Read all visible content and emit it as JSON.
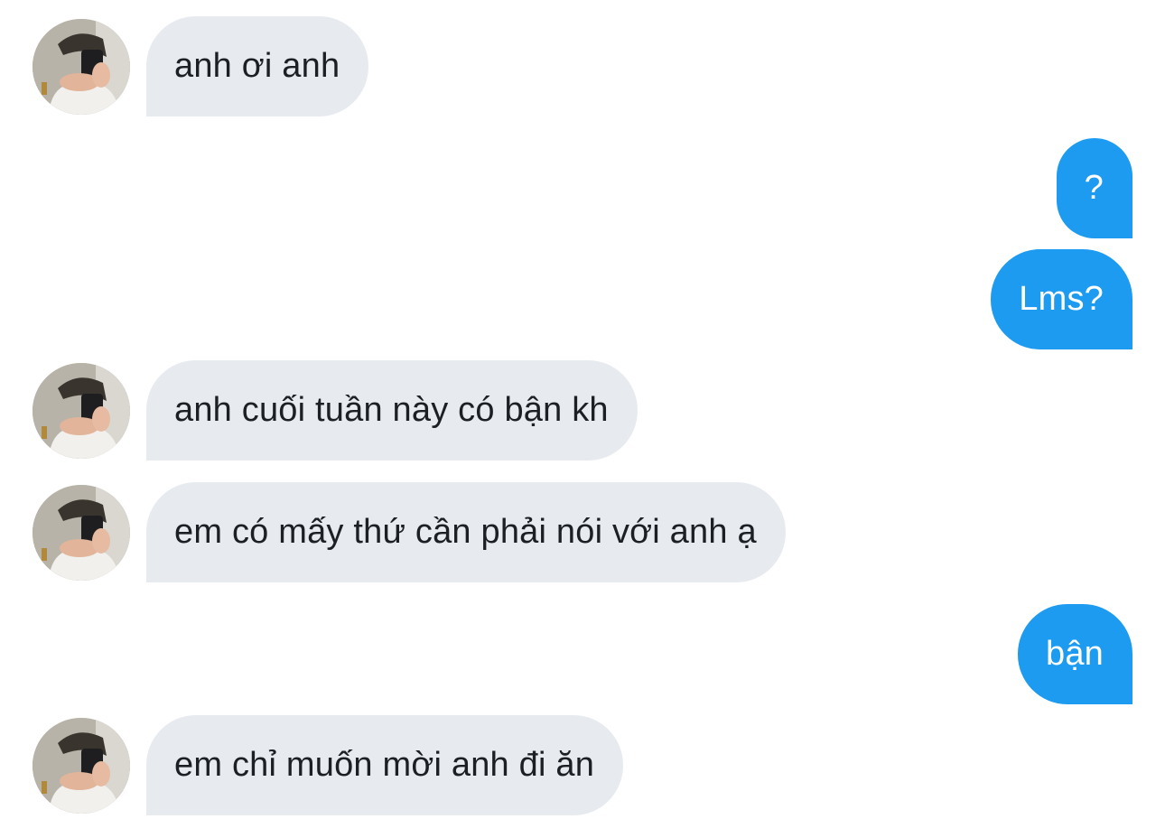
{
  "conversation": {
    "messages": [
      {
        "direction": "incoming",
        "text": "anh ơi anh"
      },
      {
        "direction": "outgoing",
        "text": "?"
      },
      {
        "direction": "outgoing",
        "text": "Lms?"
      },
      {
        "direction": "incoming",
        "text": "anh cuối tuần này có bận kh"
      },
      {
        "direction": "incoming",
        "text": "em có mấy thứ cần phải nói với anh ạ"
      },
      {
        "direction": "outgoing",
        "text": "bận"
      },
      {
        "direction": "incoming",
        "text": "em chỉ muốn mời anh đi ăn"
      }
    ],
    "colors": {
      "incoming_bubble": "#e7ebf0",
      "incoming_text": "#1c1f23",
      "outgoing_bubble": "#1d9bf0",
      "outgoing_text": "#ffffff"
    }
  }
}
